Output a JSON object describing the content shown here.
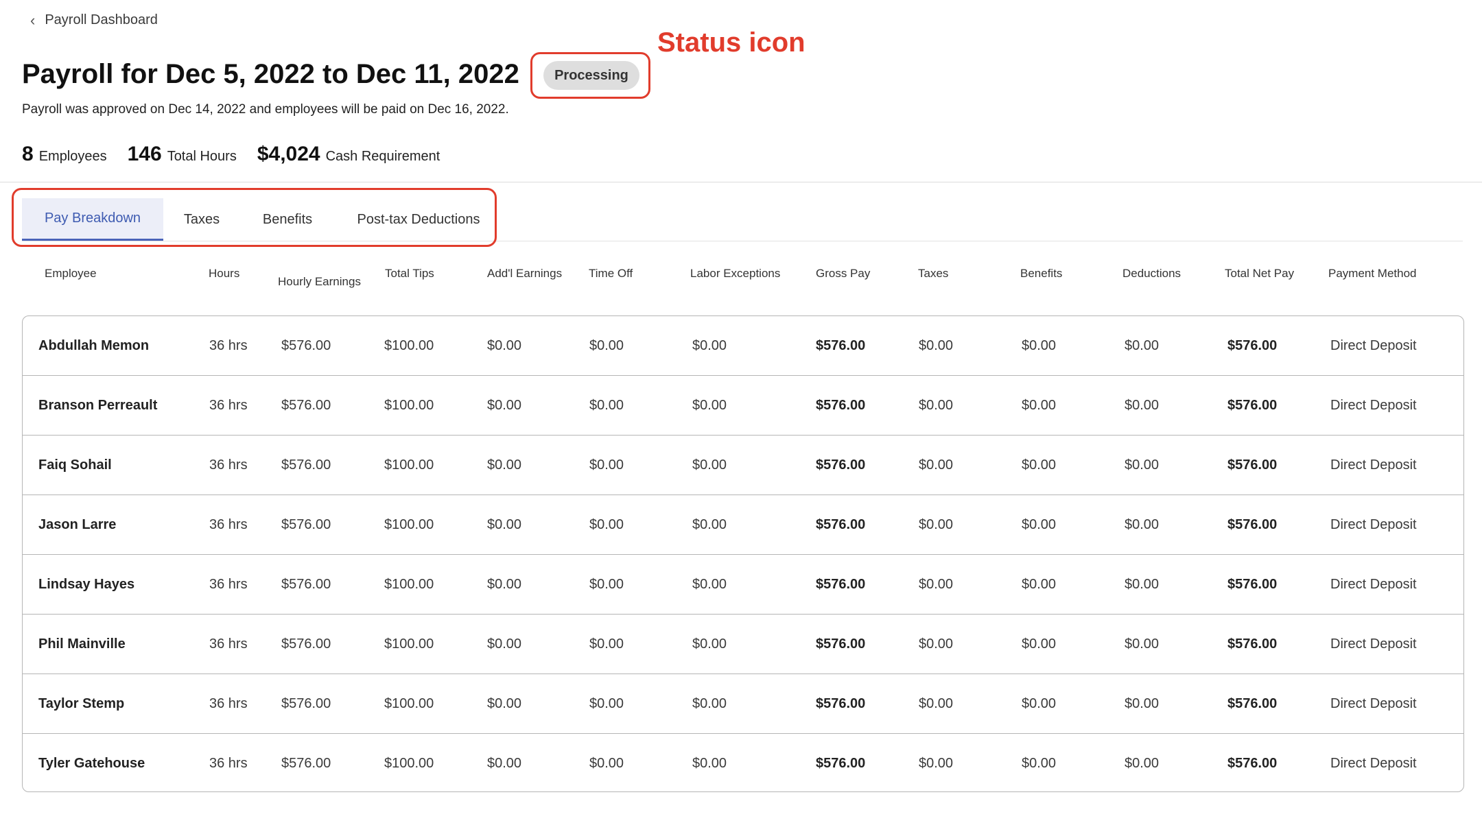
{
  "breadcrumb": {
    "label": "Payroll Dashboard"
  },
  "header": {
    "title": "Payroll for Dec 5, 2022 to Dec 11, 2022",
    "status": "Processing",
    "subtitle": "Payroll was approved on Dec 14, 2022 and employees will be paid on Dec 16, 2022."
  },
  "annotations": {
    "status_label": "Status icon",
    "color": "#e13c2c"
  },
  "stats": [
    {
      "value": "8",
      "label": "Employees"
    },
    {
      "value": "146",
      "label": "Total Hours"
    },
    {
      "value": "$4,024",
      "label": "Cash Requirement"
    }
  ],
  "tabs": [
    {
      "label": "Pay Breakdown",
      "active": true
    },
    {
      "label": "Taxes",
      "active": false
    },
    {
      "label": "Benefits",
      "active": false
    },
    {
      "label": "Post-tax Deductions",
      "active": false
    }
  ],
  "table": {
    "headers": [
      "Employee",
      "Hours",
      "Hourly Earnings",
      "Total Tips",
      "Add'l Earnings",
      "Time Off",
      "Labor Exceptions",
      "Gross Pay",
      "Taxes",
      "Benefits",
      "Deductions",
      "Total Net Pay",
      "Payment Method"
    ],
    "rows": [
      [
        "Abdullah Memon",
        "36 hrs",
        "$576.00",
        "$100.00",
        "$0.00",
        "$0.00",
        "$0.00",
        "$576.00",
        "$0.00",
        "$0.00",
        "$0.00",
        "$576.00",
        "Direct Deposit"
      ],
      [
        "Branson Perreault",
        "36 hrs",
        "$576.00",
        "$100.00",
        "$0.00",
        "$0.00",
        "$0.00",
        "$576.00",
        "$0.00",
        "$0.00",
        "$0.00",
        "$576.00",
        "Direct Deposit"
      ],
      [
        "Faiq Sohail",
        "36 hrs",
        "$576.00",
        "$100.00",
        "$0.00",
        "$0.00",
        "$0.00",
        "$576.00",
        "$0.00",
        "$0.00",
        "$0.00",
        "$576.00",
        "Direct Deposit"
      ],
      [
        "Jason Larre",
        "36 hrs",
        "$576.00",
        "$100.00",
        "$0.00",
        "$0.00",
        "$0.00",
        "$576.00",
        "$0.00",
        "$0.00",
        "$0.00",
        "$576.00",
        "Direct Deposit"
      ],
      [
        "Lindsay Hayes",
        "36 hrs",
        "$576.00",
        "$100.00",
        "$0.00",
        "$0.00",
        "$0.00",
        "$576.00",
        "$0.00",
        "$0.00",
        "$0.00",
        "$576.00",
        "Direct Deposit"
      ],
      [
        "Phil Mainville",
        "36 hrs",
        "$576.00",
        "$100.00",
        "$0.00",
        "$0.00",
        "$0.00",
        "$576.00",
        "$0.00",
        "$0.00",
        "$0.00",
        "$576.00",
        "Direct Deposit"
      ],
      [
        "Taylor Stemp",
        "36 hrs",
        "$576.00",
        "$100.00",
        "$0.00",
        "$0.00",
        "$0.00",
        "$576.00",
        "$0.00",
        "$0.00",
        "$0.00",
        "$576.00",
        "Direct Deposit"
      ],
      [
        "Tyler Gatehouse",
        "36 hrs",
        "$576.00",
        "$100.00",
        "$0.00",
        "$0.00",
        "$0.00",
        "$576.00",
        "$0.00",
        "$0.00",
        "$0.00",
        "$576.00",
        "Direct Deposit"
      ]
    ]
  }
}
